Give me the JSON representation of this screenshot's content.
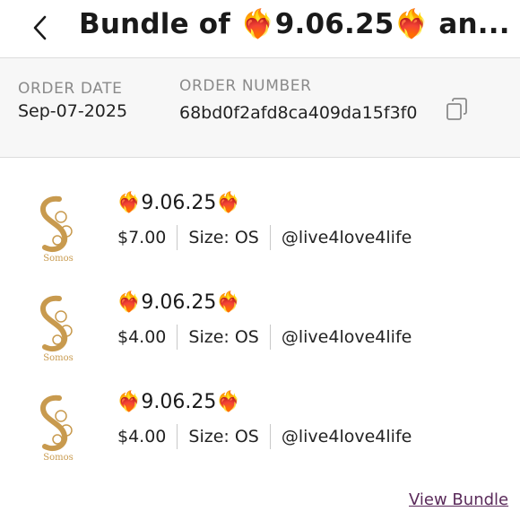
{
  "header": {
    "title": "Bundle of ❤️‍🔥9.06.25❤️‍🔥 an..."
  },
  "order": {
    "date_label": "ORDER DATE",
    "date_value": "Sep-07-2025",
    "number_label": "ORDER NUMBER",
    "number_value": "68bd0f2afd8ca409da15f3f0"
  },
  "items": [
    {
      "title": "❤️‍🔥9.06.25❤️‍🔥",
      "price": "$7.00",
      "size": "Size: OS",
      "seller": "@live4love4life",
      "logo_text": "Somos"
    },
    {
      "title": "❤️‍🔥9.06.25❤️‍🔥",
      "price": "$4.00",
      "size": "Size: OS",
      "seller": "@live4love4life",
      "logo_text": "Somos"
    },
    {
      "title": "❤️‍🔥9.06.25❤️‍🔥",
      "price": "$4.00",
      "size": "Size: OS",
      "seller": "@live4love4life",
      "logo_text": "Somos"
    }
  ],
  "footer": {
    "view_bundle": "View Bundle"
  },
  "colors": {
    "logo_gold": "#c89a4e",
    "link_purple": "#5a2a5a"
  },
  "icons": {
    "back": "chevron-left-icon",
    "copy": "copy-icon",
    "thumbnail": "somos-logo-icon"
  }
}
